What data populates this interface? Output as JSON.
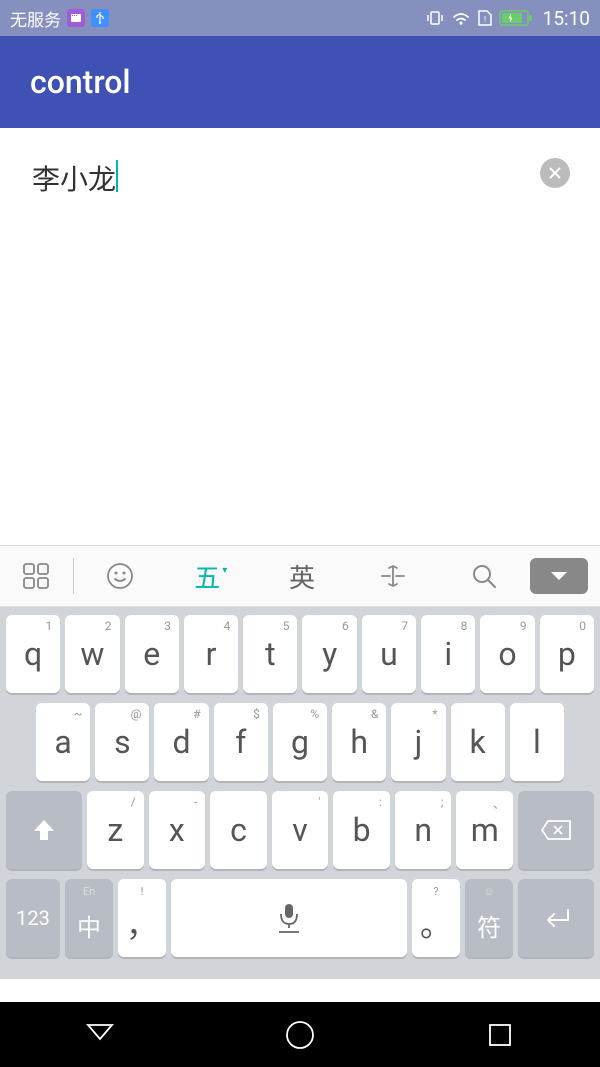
{
  "status": {
    "carrier": "无服务",
    "time": "15:10"
  },
  "header": {
    "title": "control"
  },
  "input": {
    "value": "李小龙"
  },
  "toolbar": {
    "method": "五",
    "english": "英"
  },
  "keyboard": {
    "row1": [
      {
        "sup": "1",
        "main": "q"
      },
      {
        "sup": "2",
        "main": "w"
      },
      {
        "sup": "3",
        "main": "e"
      },
      {
        "sup": "4",
        "main": "r"
      },
      {
        "sup": "5",
        "main": "t"
      },
      {
        "sup": "6",
        "main": "y"
      },
      {
        "sup": "7",
        "main": "u"
      },
      {
        "sup": "8",
        "main": "i"
      },
      {
        "sup": "9",
        "main": "o"
      },
      {
        "sup": "0",
        "main": "p"
      }
    ],
    "row2": [
      {
        "sup": "~",
        "main": "a"
      },
      {
        "sup": "@",
        "main": "s"
      },
      {
        "sup": "#",
        "main": "d"
      },
      {
        "sup": "$",
        "main": "f"
      },
      {
        "sup": "%",
        "main": "g"
      },
      {
        "sup": "&",
        "main": "h"
      },
      {
        "sup": "*",
        "main": "j"
      },
      {
        "sup": "",
        "main": "k"
      },
      {
        "sup": "",
        "main": "l"
      }
    ],
    "row3": [
      {
        "sup": "/",
        "main": "z"
      },
      {
        "sup": "-",
        "main": "x"
      },
      {
        "sup": "",
        "main": "c"
      },
      {
        "sup": "'",
        "main": "v"
      },
      {
        "sup": ":",
        "main": "b"
      },
      {
        "sup": ";",
        "main": "n"
      },
      {
        "sup": "、",
        "main": "m"
      }
    ],
    "num_key": "123",
    "lang_sup": "En",
    "lang_main": "中",
    "comma_sup": "!",
    "comma_main": "，",
    "period_sup": "?",
    "period_main": "。",
    "symbol_sup": "☺",
    "symbol_main": "符"
  }
}
